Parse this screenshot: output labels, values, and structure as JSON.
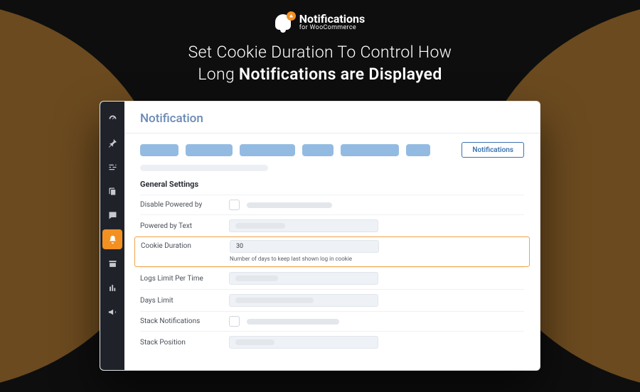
{
  "brand": {
    "name": "Notifications",
    "subtitle": "for WooCommerce"
  },
  "headline": {
    "line1": "Set Cookie Duration To Control How",
    "line2_prefix": "Long ",
    "line2_bold": "Notifications are Displayed"
  },
  "page": {
    "title": "Notification",
    "active_tab_label": "Notifications",
    "section_heading": "General Settings"
  },
  "settings": {
    "disable_powered_by": {
      "label": "Disable Powered by"
    },
    "powered_by_text": {
      "label": "Powered by Text"
    },
    "cookie_duration": {
      "label": "Cookie Duration",
      "value": "30",
      "hint": "Number of days to keep last shown log in cookie"
    },
    "logs_limit": {
      "label": "Logs Limit Per Time"
    },
    "days_limit": {
      "label": "Days Limit"
    },
    "stack_notifications": {
      "label": "Stack Notifications"
    },
    "stack_position": {
      "label": "Stack Position"
    }
  },
  "rail_icons": [
    "dashboard-icon",
    "pin-icon",
    "tune-icon",
    "copy-icon",
    "comment-icon",
    "notifications-icon",
    "archive-icon",
    "stats-icon",
    "announce-icon"
  ]
}
